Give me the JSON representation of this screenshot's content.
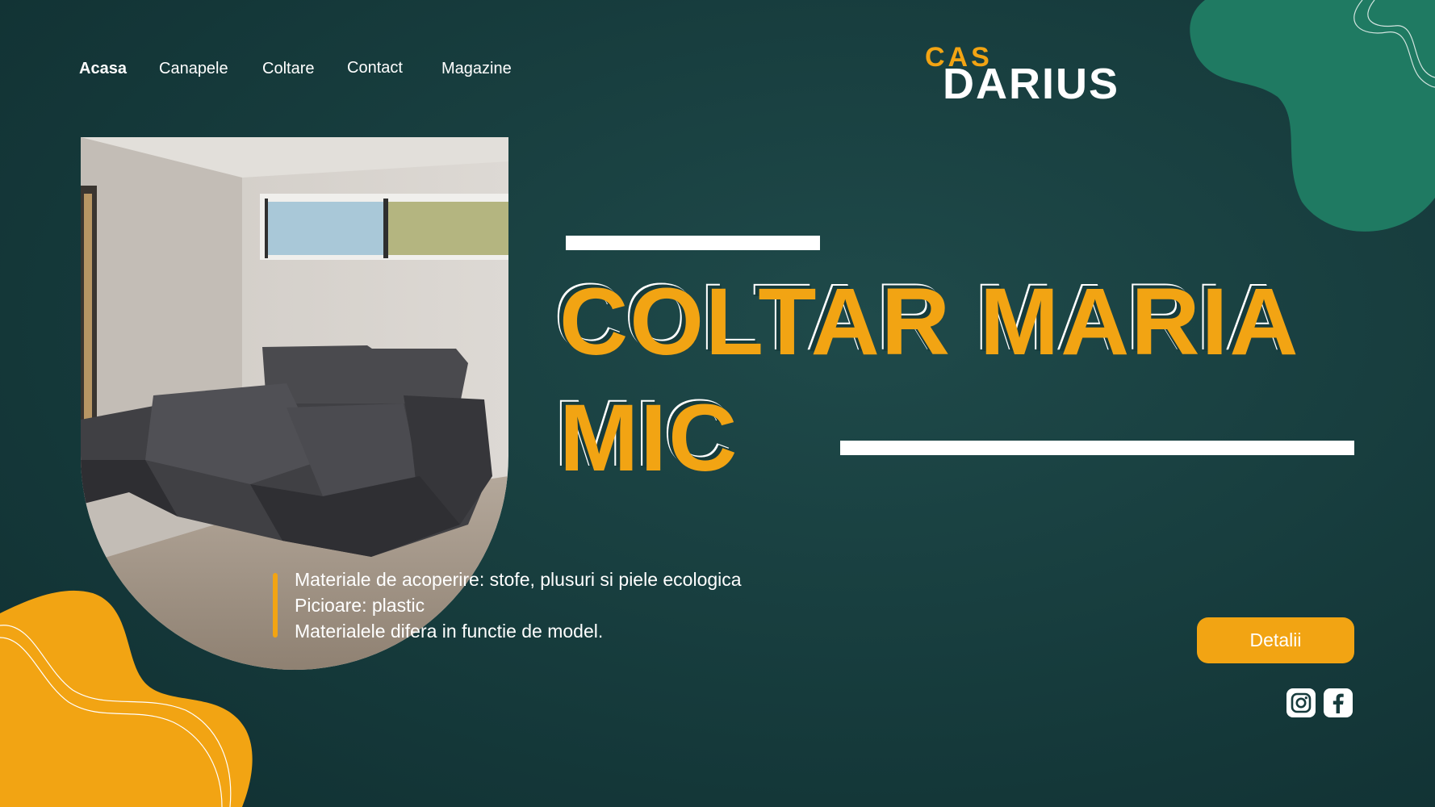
{
  "nav": {
    "items": [
      {
        "label": "Acasa",
        "active": true
      },
      {
        "label": "Canapele",
        "active": false
      },
      {
        "label": "Coltare",
        "active": false
      },
      {
        "label": "Contact",
        "active": false
      },
      {
        "label": "Magazine",
        "active": false
      }
    ]
  },
  "logo": {
    "top": "CAS",
    "main": "DARIUS"
  },
  "hero": {
    "title_line1": "COLTAR MARIA",
    "title_line2": "MIC",
    "description": [
      "Materiale de acoperire: stofe, plusuri si piele ecologica",
      "Picioare: plastic",
      "Materialele difera in functie de model."
    ],
    "cta_label": "Detalii"
  },
  "social": [
    {
      "icon": "instagram-icon"
    },
    {
      "icon": "facebook-icon"
    }
  ],
  "colors": {
    "background": "#163b3c",
    "accent": "#f2a413",
    "decor_green": "#1f7a62",
    "text": "#ffffff"
  }
}
